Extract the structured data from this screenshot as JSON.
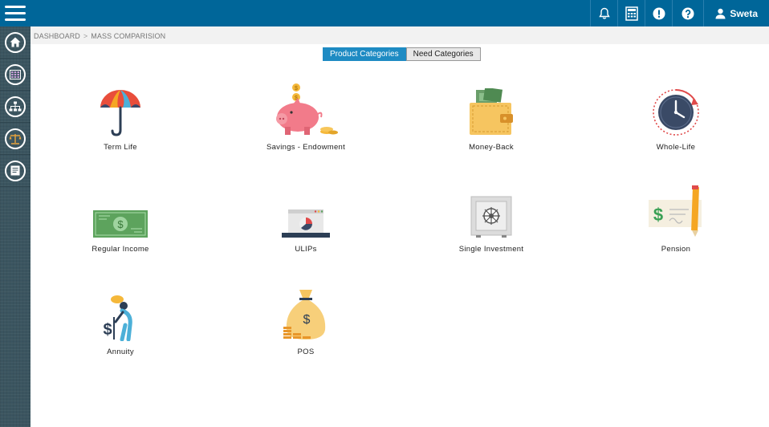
{
  "header": {
    "user_name": "Sweta"
  },
  "breadcrumb": {
    "root": "DASHBOARD",
    "separator": ">",
    "current": "MASS COMPARISION"
  },
  "tabs": {
    "product": "Product Categories",
    "need": "Need Categories"
  },
  "categories": [
    {
      "label": "Term Life",
      "icon": "umbrella-icon"
    },
    {
      "label": "Savings - Endowment",
      "icon": "piggy-bank-icon"
    },
    {
      "label": "Money-Back",
      "icon": "wallet-icon"
    },
    {
      "label": "Whole-Life",
      "icon": "clock-icon"
    },
    {
      "label": "Regular Income",
      "icon": "banknote-icon"
    },
    {
      "label": "ULIPs",
      "icon": "laptop-chart-icon"
    },
    {
      "label": "Single Investment",
      "icon": "safe-icon"
    },
    {
      "label": "Pension",
      "icon": "cheque-icon"
    },
    {
      "label": "Annuity",
      "icon": "elderly-icon"
    },
    {
      "label": "POS",
      "icon": "money-bag-icon"
    }
  ],
  "colors": {
    "topbar": "#006699",
    "sidebar": "#3b5560",
    "active_tab": "#1e8bc3"
  }
}
